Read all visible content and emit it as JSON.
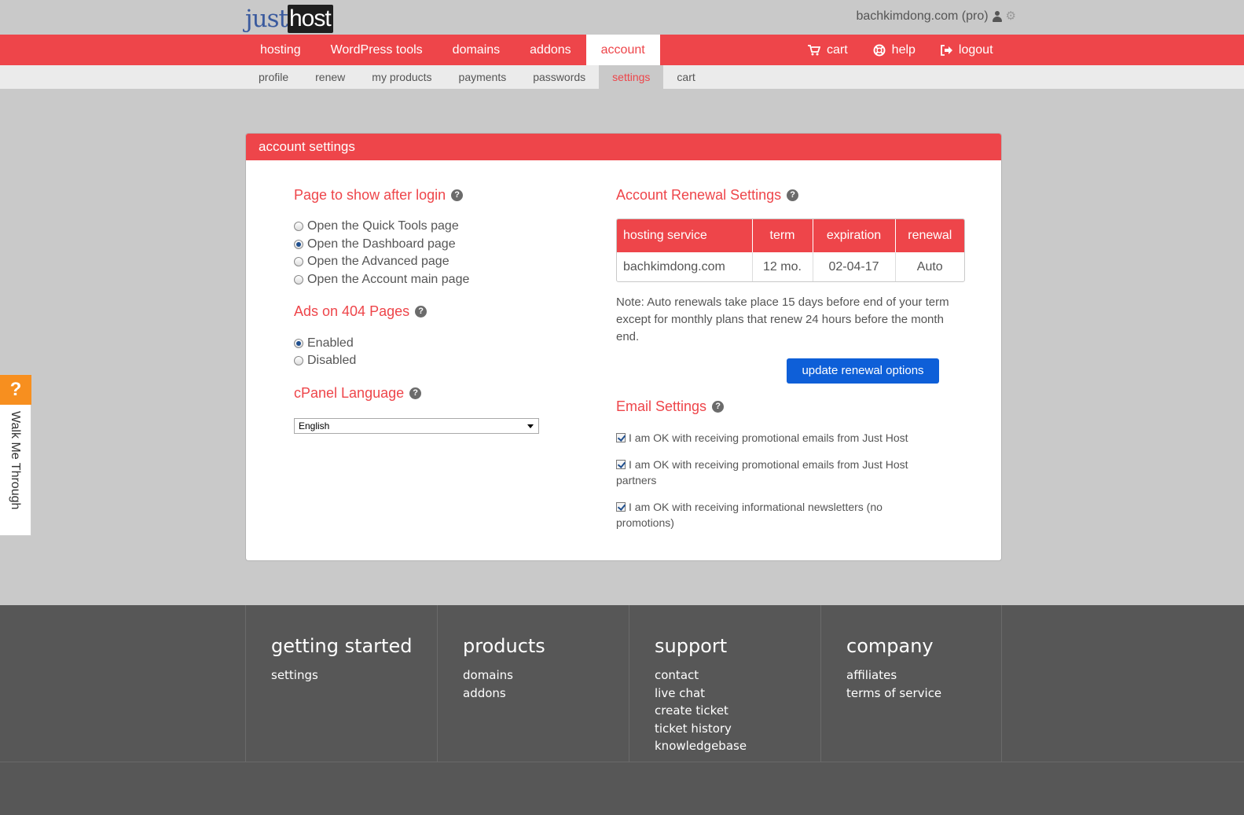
{
  "logo": {
    "part1": "just",
    "part2": "host"
  },
  "user": {
    "name": "bachkimdong.com (pro)"
  },
  "main_nav": {
    "items": [
      "hosting",
      "WordPress tools",
      "domains",
      "addons",
      "account"
    ],
    "active": "account",
    "right": {
      "cart": "cart",
      "help": "help",
      "logout": "logout"
    }
  },
  "sub_nav": {
    "items": [
      "profile",
      "renew",
      "my products",
      "payments",
      "passwords",
      "settings",
      "cart"
    ],
    "active": "settings"
  },
  "panel": {
    "title": "account settings",
    "login_page": {
      "title": "Page to show after login",
      "options": [
        "Open the Quick Tools page",
        "Open the Dashboard page",
        "Open the Advanced page",
        "Open the Account main page"
      ],
      "selected": "Open the Dashboard page"
    },
    "ads": {
      "title": "Ads on 404 Pages",
      "options": [
        "Enabled",
        "Disabled"
      ],
      "selected": "Enabled"
    },
    "language": {
      "title": "cPanel Language",
      "value": "English"
    },
    "renewal": {
      "title": "Account Renewal Settings",
      "headers": [
        "hosting service",
        "term",
        "expiration",
        "renewal"
      ],
      "rows": [
        [
          "bachkimdong.com",
          "12 mo.",
          "02-04-17",
          "Auto"
        ]
      ],
      "note": "Note: Auto renewals take place 15 days before end of your term except for monthly plans that renew 24 hours before the month end.",
      "button": "update renewal options"
    },
    "email": {
      "title": "Email Settings",
      "options": [
        {
          "label": "I am OK with receiving promotional emails from Just Host",
          "checked": true
        },
        {
          "label": "I am OK with receiving promotional emails from Just Host partners",
          "checked": true
        },
        {
          "label": "I am OK with receiving informational newsletters (no promotions)",
          "checked": true
        }
      ]
    }
  },
  "walkme": {
    "icon": "?",
    "label": "Walk Me Through"
  },
  "footer": {
    "columns": [
      {
        "heading": "getting started",
        "links": [
          "settings"
        ]
      },
      {
        "heading": "products",
        "links": [
          "domains",
          "addons"
        ]
      },
      {
        "heading": "support",
        "links": [
          "contact",
          "live chat",
          "create ticket",
          "ticket history",
          "knowledgebase"
        ]
      },
      {
        "heading": "company",
        "links": [
          "affiliates",
          "terms of service"
        ]
      }
    ]
  },
  "colors": {
    "brand_red": "#ee454a",
    "button_blue": "#0e5fd8",
    "footer_bg": "#575757",
    "walkme_orange": "#f78f1f"
  }
}
